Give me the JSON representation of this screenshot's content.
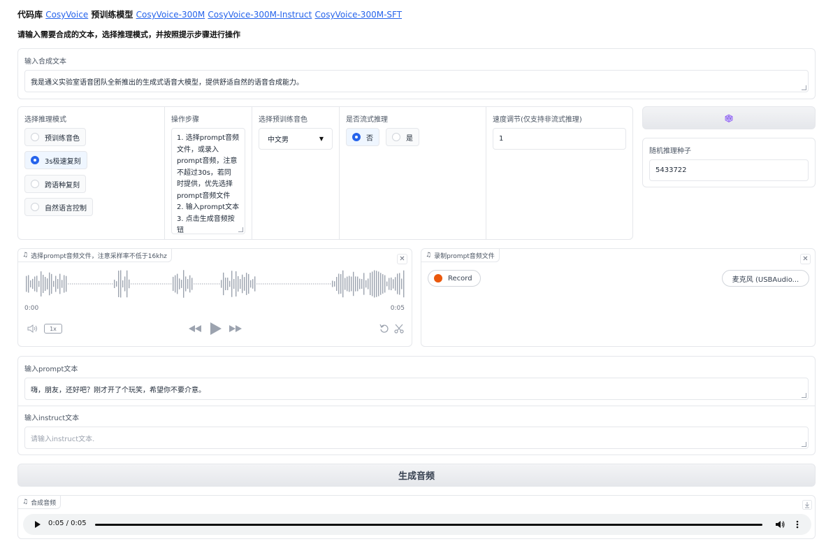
{
  "header": {
    "prefix_code": "代码库",
    "link_cosyvoice": "CosyVoice",
    "prefix_models": "预训练模型",
    "link_300m": "CosyVoice-300M",
    "link_instruct": "CosyVoice-300M-Instruct",
    "link_sft": "CosyVoice-300M-SFT",
    "subtitle": "请输入需要合成的文本，选择推理模式，并按照提示步骤进行操作"
  },
  "tts_text": {
    "label": "输入合成文本",
    "value": "我是通义实验室语音团队全新推出的生成式语音大模型，提供舒适自然的语音合成能力。"
  },
  "mode": {
    "label": "选择推理模式",
    "options": [
      "预训练音色",
      "3s极速复刻",
      "跨语种复刻",
      "自然语言控制"
    ],
    "selected": "3s极速复刻"
  },
  "steps": {
    "label": "操作步骤",
    "lines": [
      "1. 选择prompt音频",
      "文件，或录入",
      "prompt音频，注意",
      "不超过30s，若同",
      "时提供，优先选择",
      "prompt音频文件",
      "2. 输入prompt文本",
      "3. 点击生成音频按",
      "钮"
    ]
  },
  "voice": {
    "label": "选择预训练音色",
    "selected": "中文男"
  },
  "stream": {
    "label": "是否流式推理",
    "options": [
      "否",
      "是"
    ],
    "selected": "否"
  },
  "speed": {
    "label": "速度调节(仅支持非流式推理)",
    "value": "1"
  },
  "dice_button": {
    "icon": "dice-icon"
  },
  "seed": {
    "label": "随机推理种子",
    "value": "5433722"
  },
  "prompt_audio": {
    "label": "选择prompt音频文件，注意采样率不低于16khz",
    "time_start": "0:00",
    "time_end": "0:05",
    "playback_rate": "1x"
  },
  "record_audio": {
    "label": "录制prompt音频文件",
    "record_label": "Record",
    "device": "麦克风 (USBAudio..."
  },
  "prompt_text": {
    "label": "输入prompt文本",
    "value": "嗨，朋友，还好吧？刚才开了个玩笑，希望你不要介意。"
  },
  "instruct_text": {
    "label": "输入instruct文本",
    "placeholder": "请输入instruct文本."
  },
  "generate_button": {
    "label": "生成音频"
  },
  "output_audio": {
    "label": "合成音频",
    "time": "0:05 / 0:05"
  }
}
